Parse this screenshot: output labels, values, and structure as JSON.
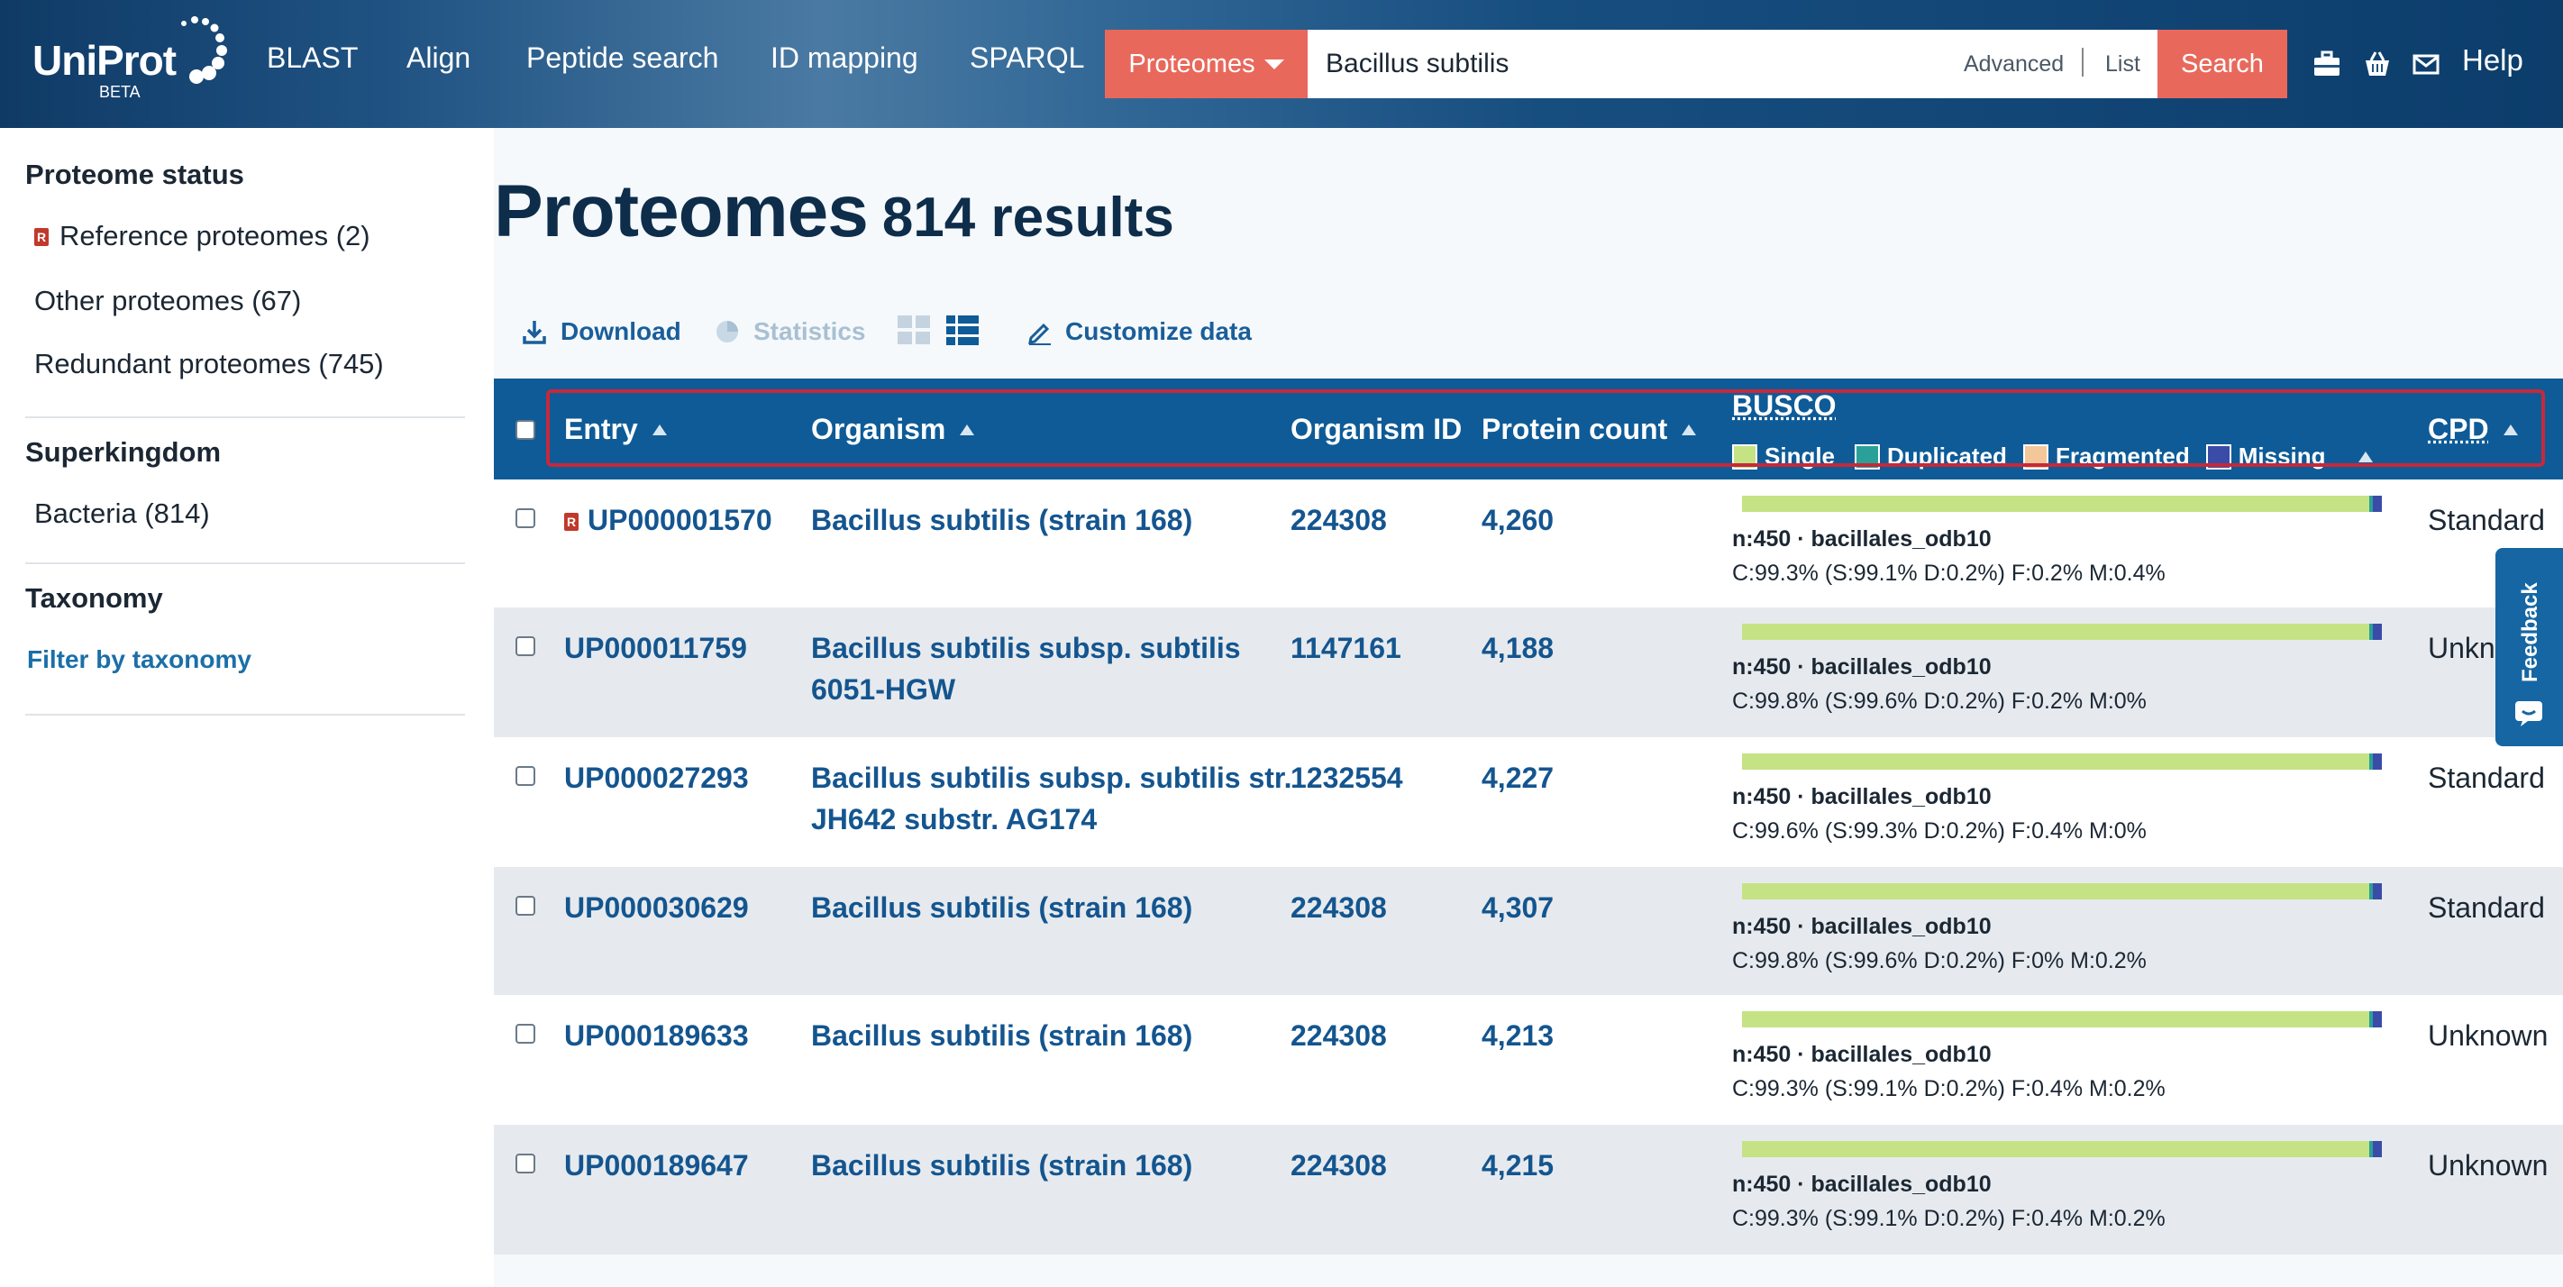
{
  "header": {
    "logo_text": "UniProt",
    "logo_beta": "BETA",
    "nav": [
      "BLAST",
      "Align",
      "Peptide search",
      "ID mapping",
      "SPARQL"
    ],
    "dataset_dropdown": "Proteomes",
    "search_value": "Bacillus subtilis",
    "advanced_label": "Advanced",
    "list_label": "List",
    "search_button": "Search",
    "icons": [
      "toolkit-icon",
      "basket-icon",
      "mail-icon"
    ],
    "help_label": "Help"
  },
  "sidebar": {
    "status_heading": "Proteome status",
    "status_items": [
      "Reference proteomes (2)",
      "Other proteomes (67)",
      "Redundant proteomes (745)"
    ],
    "superkingdom_heading": "Superkingdom",
    "superkingdom_items": [
      "Bacteria (814)"
    ],
    "taxonomy_heading": "Taxonomy",
    "taxonomy_link": "Filter by taxonomy"
  },
  "main": {
    "title": "Proteomes",
    "result_count": "814 results",
    "toolbar": {
      "download": "Download",
      "statistics": "Statistics",
      "customize": "Customize data"
    },
    "columns": {
      "entry": "Entry",
      "organism": "Organism",
      "organism_id": "Organism ID",
      "protein_count": "Protein count",
      "busco": "BUSCO",
      "cpd": "CPD"
    },
    "busco_legend": [
      {
        "label": "Single",
        "color": "#c5e384"
      },
      {
        "label": "Duplicated",
        "color": "#2aa198"
      },
      {
        "label": "Fragmented",
        "color": "#f3c79a"
      },
      {
        "label": "Missing",
        "color": "#3b4ba8"
      }
    ],
    "rows": [
      {
        "entry": "UP000001570",
        "reference": true,
        "organism_lines": [
          "Bacillus subtilis (strain 168)"
        ],
        "organism_id": "224308",
        "protein_count": "4,260",
        "busco_meta": "n:450 · bacillales_odb10",
        "busco_stats": "C:99.3% (S:99.1% D:0.2%) F:0.2% M:0.4%",
        "cpd": "Standard"
      },
      {
        "entry": "UP000011759",
        "reference": false,
        "organism_lines": [
          "Bacillus subtilis subsp. subtilis",
          "6051-HGW"
        ],
        "organism_id": "1147161",
        "protein_count": "4,188",
        "busco_meta": "n:450 · bacillales_odb10",
        "busco_stats": "C:99.8% (S:99.6% D:0.2%) F:0.2% M:0%",
        "cpd": "Unknown"
      },
      {
        "entry": "UP000027293",
        "reference": false,
        "organism_lines": [
          "Bacillus subtilis subsp. subtilis str.",
          "JH642 substr. AG174"
        ],
        "organism_id": "1232554",
        "protein_count": "4,227",
        "busco_meta": "n:450 · bacillales_odb10",
        "busco_stats": "C:99.6% (S:99.3% D:0.2%) F:0.4% M:0%",
        "cpd": "Standard"
      },
      {
        "entry": "UP000030629",
        "reference": false,
        "organism_lines": [
          "Bacillus subtilis (strain 168)"
        ],
        "organism_id": "224308",
        "protein_count": "4,307",
        "busco_meta": "n:450 · bacillales_odb10",
        "busco_stats": "C:99.8% (S:99.6% D:0.2%) F:0% M:0.2%",
        "cpd": "Standard"
      },
      {
        "entry": "UP000189633",
        "reference": false,
        "organism_lines": [
          "Bacillus subtilis (strain 168)"
        ],
        "organism_id": "224308",
        "protein_count": "4,213",
        "busco_meta": "n:450 · bacillales_odb10",
        "busco_stats": "C:99.3% (S:99.1% D:0.2%) F:0.4% M:0.2%",
        "cpd": "Unknown"
      },
      {
        "entry": "UP000189647",
        "reference": false,
        "organism_lines": [
          "Bacillus subtilis (strain 168)"
        ],
        "organism_id": "224308",
        "protein_count": "4,215",
        "busco_meta": "n:450 · bacillales_odb10",
        "busco_stats": "C:99.3% (S:99.1% D:0.2%) F:0.4% M:0.2%",
        "cpd": "Unknown"
      }
    ],
    "feedback_label": "Feedback"
  }
}
